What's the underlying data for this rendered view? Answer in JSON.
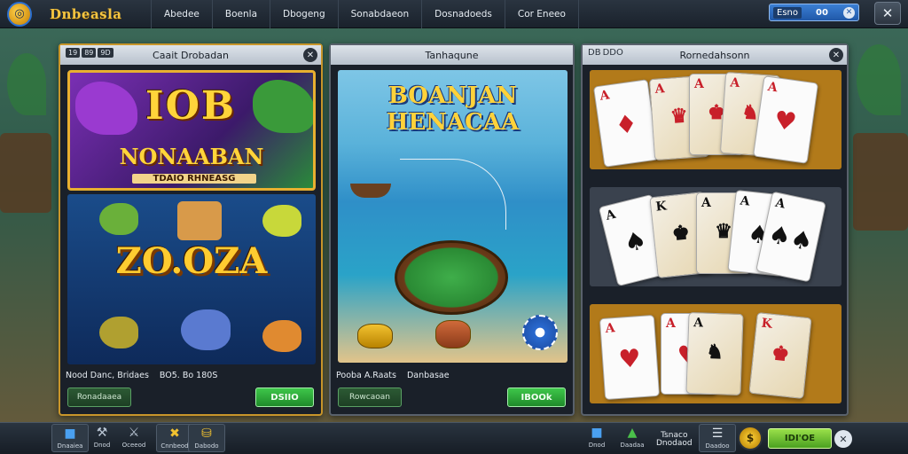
{
  "topbar": {
    "logo_icon": "dice-coin-icon",
    "brand": "Dnbeasla",
    "nav": [
      "Abedee",
      "Boenla",
      "Dbogeng",
      "Sonabdaeon",
      "Dosnadoeds",
      "Cor Eneeo"
    ],
    "account_name": "Esno",
    "balance": "00",
    "close_icon": "close-icon"
  },
  "panels": {
    "slot": {
      "title": "Caait Drobadan",
      "tags": [
        "19",
        "89",
        "9D"
      ],
      "banner_top": "IOB",
      "banner_mid": "NONAABAN",
      "banner_sub": "TDAIO RHNEASG",
      "multiplier": "ZO.OZA",
      "info_left": "Nood Danc, Bridaes",
      "info_right": "BO5. Bo 180S",
      "btn_left": "Ronadaaea",
      "btn_right": "DSIIO"
    },
    "fishing": {
      "title": "Tanhaqune",
      "banner_line1": "BOANJAN",
      "banner_line2": "HENACAA",
      "info_left": "Pooba A.Raats",
      "info_right": "Danbasae",
      "btn_left": "Rowcaoan",
      "btn_right": "IBOOk"
    },
    "cards": {
      "title": "Rornedahsonn",
      "tags": [
        "DB",
        "DDO"
      ]
    }
  },
  "bottombar": {
    "items": [
      {
        "label": "Dnaaiea",
        "icon": "cube-icon"
      },
      {
        "label": "Dnod",
        "icon": "tools-icon"
      },
      {
        "label": "Oceeod",
        "icon": "swords-icon"
      },
      {
        "label": "Cnnbeod",
        "icon": "crossed-tools-icon"
      },
      {
        "label": "Dabodo",
        "icon": "coins-icon"
      }
    ],
    "right_items": [
      {
        "label": "Dnod",
        "icon": "cube-icon"
      },
      {
        "label": "Daadaa",
        "icon": "tree-icon"
      }
    ],
    "text_line1": "Tsnaco",
    "text_line2": "Dnodaod",
    "list_icon": "list-icon",
    "list_label": "Daadoo",
    "coin_icon": "coin-icon",
    "play_label": "IDI'OE",
    "close_icon": "close-icon"
  }
}
